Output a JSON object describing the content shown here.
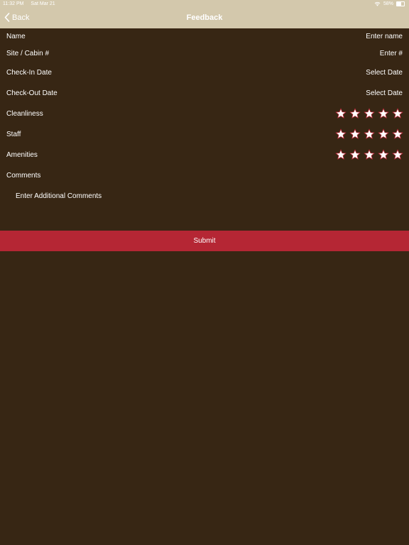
{
  "status_bar": {
    "time": "11:32 PM",
    "date": "Sat Mar 21",
    "battery": "58%",
    "battery_level": 0.58
  },
  "nav": {
    "back_label": "Back",
    "title": "Feedback"
  },
  "form": {
    "name": {
      "label": "Name",
      "placeholder": "Enter name"
    },
    "site": {
      "label": "Site / Cabin #",
      "placeholder": "Enter #"
    },
    "check_in": {
      "label": "Check-In Date",
      "placeholder": "Select Date"
    },
    "check_out": {
      "label": "Check-Out Date",
      "placeholder": "Select Date"
    },
    "ratings": [
      {
        "label": "Cleanliness",
        "stars": 5
      },
      {
        "label": "Staff",
        "stars": 5
      },
      {
        "label": "Amenities",
        "stars": 5
      }
    ],
    "comments": {
      "label": "Comments",
      "placeholder": "Enter Additional Comments"
    }
  },
  "submit_label": "Submit",
  "colors": {
    "background": "#372614",
    "header": "#d3c8ac",
    "submit": "#b52634",
    "star_fill": "#ffffff",
    "star_outline": "#b52634"
  }
}
